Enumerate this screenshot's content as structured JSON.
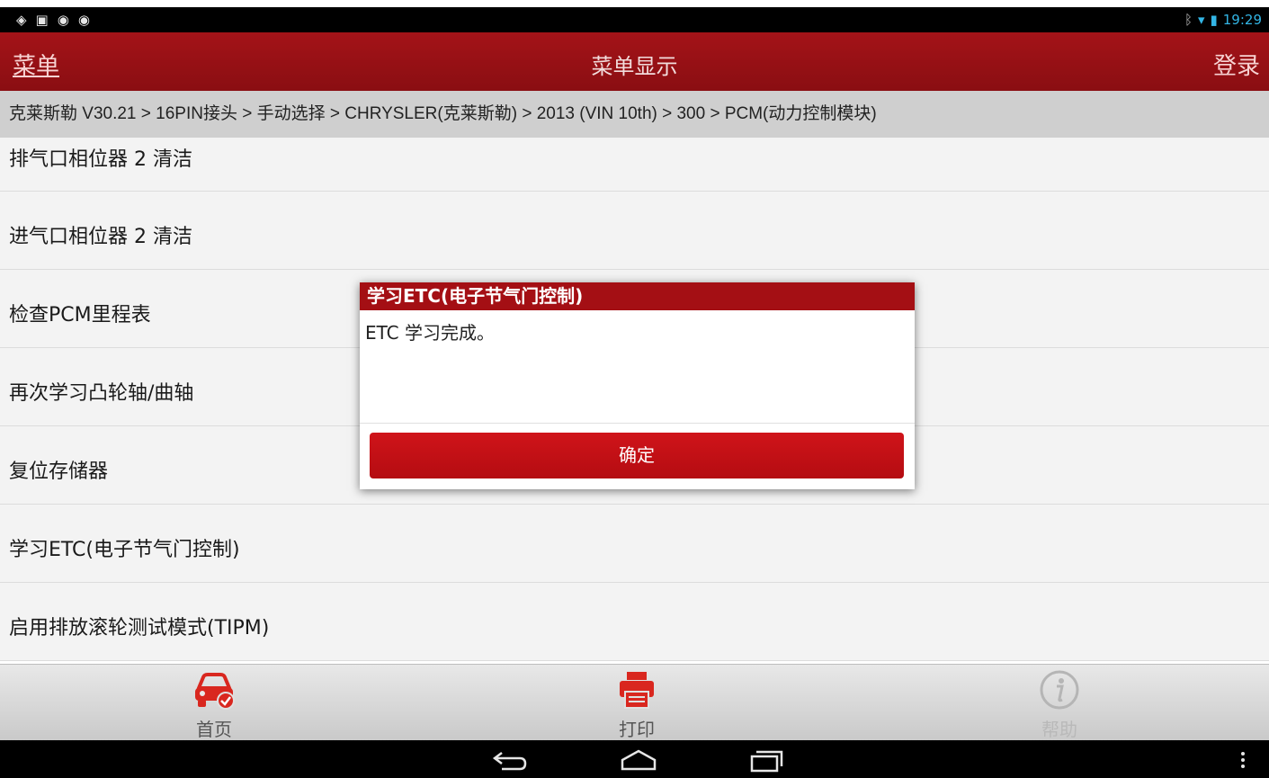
{
  "status_bar": {
    "time": "19:29",
    "left_icons": [
      "gps-icon",
      "image-icon",
      "chat-icon",
      "chat-icon"
    ],
    "right_icons": [
      "bluetooth-icon",
      "wifi-icon",
      "battery-icon"
    ]
  },
  "header": {
    "menu_label": "菜单",
    "title": "菜单显示",
    "login_label": "登录"
  },
  "breadcrumb": "克莱斯勒 V30.21 > 16PIN接头 > 手动选择 > CHRYSLER(克莱斯勒) > 2013 (VIN 10th) > 300 > PCM(动力控制模块)",
  "menu_items": [
    "排气口相位器 2 清洁",
    "进气口相位器 2 清洁",
    "检查PCM里程表",
    "再次学习凸轮轴/曲轴",
    "复位存储器",
    "学习ETC(电子节气门控制)",
    "启用排放滚轮测试模式(TIPM)"
  ],
  "dialog": {
    "title": "学习ETC(电子节气门控制)",
    "message": "ETC 学习完成。",
    "ok_label": "确定"
  },
  "toolbar": {
    "home_label": "首页",
    "print_label": "打印",
    "help_label": "帮助"
  },
  "colors": {
    "brand_red": "#a41318",
    "button_red": "#c8101a",
    "status_blue": "#33b5e5"
  }
}
